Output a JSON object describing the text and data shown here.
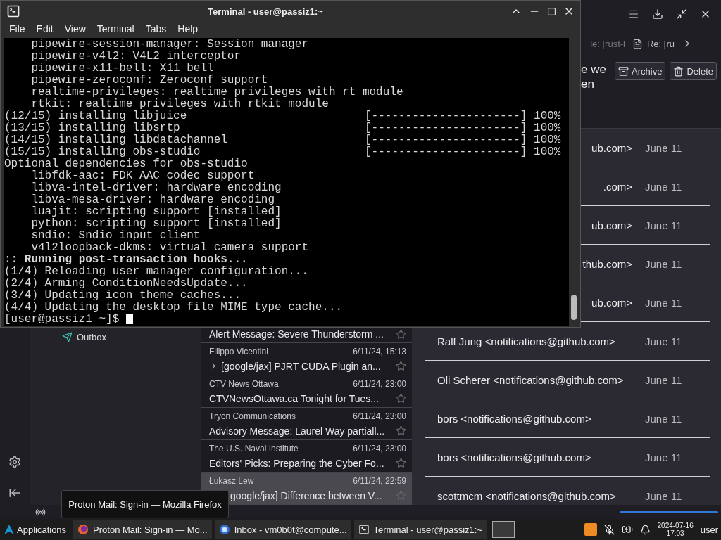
{
  "terminal": {
    "title": "Terminal - user@passiz1:~",
    "menu": [
      "File",
      "Edit",
      "View",
      "Terminal",
      "Tabs",
      "Help"
    ],
    "lines": [
      {
        "text": "    pipewire-session-manager: Session manager"
      },
      {
        "text": "    pipewire-v4l2: V4L2 interceptor"
      },
      {
        "text": "    pipewire-x11-bell: X11 bell"
      },
      {
        "text": "    pipewire-zeroconf: Zeroconf support"
      },
      {
        "text": "    realtime-privileges: realtime privileges with rt module"
      },
      {
        "text": "    rtkit: realtime privileges with rtkit module"
      },
      {
        "text": "(12/15) installing libjuice",
        "progress": "[----------------------] 100%"
      },
      {
        "text": "(13/15) installing libsrtp",
        "progress": "[----------------------] 100%"
      },
      {
        "text": "(14/15) installing libdatachannel",
        "progress": "[----------------------] 100%"
      },
      {
        "text": "(15/15) installing obs-studio",
        "progress": "[----------------------] 100%"
      },
      {
        "text": "Optional dependencies for obs-studio"
      },
      {
        "text": "    libfdk-aac: FDK AAC codec support"
      },
      {
        "text": "    libva-intel-driver: hardware encoding"
      },
      {
        "text": "    libva-mesa-driver: hardware encoding"
      },
      {
        "text": "    luajit: scripting support [installed]"
      },
      {
        "text": "    python: scripting support [installed]"
      },
      {
        "text": "    sndio: Sndio input client"
      },
      {
        "text": "    v4l2loopback-dkms: virtual camera support"
      },
      {
        "text": ":: **Running post-transaction hooks...**"
      },
      {
        "text": "(1/4) Reloading user manager configuration..."
      },
      {
        "text": "(2/4) Arming ConditionNeedsUpdate..."
      },
      {
        "text": "(3/4) Updating icon theme caches..."
      },
      {
        "text": "(4/4) Updating the desktop file MIME type cache..."
      }
    ],
    "prompt": "[user@passiz1 ~]$ "
  },
  "mail": {
    "tabs": [
      {
        "label": "le: [rust-l",
        "cut": true
      },
      {
        "label": "Re: [ru",
        "cut": false
      }
    ],
    "subject_lines": [
      "e we",
      "en"
    ],
    "actions": [
      {
        "label": "Archive",
        "kind": "archive"
      },
      {
        "label": "Delete",
        "kind": "delete"
      }
    ],
    "folders": [
      {
        "name": "Outbox"
      }
    ],
    "threads": [
      {
        "subject": "Alert Message: Severe Thunderstorm ...",
        "kind": "partial",
        "selected": false
      },
      {
        "sender": "Filippo Vicentini",
        "date": "6/11/24, 15:13",
        "subject": "[google/jax] PJRT CUDA Plugin an...",
        "kind": "full",
        "thread": true,
        "selected": false
      },
      {
        "sender": "CTV News Ottawa",
        "date": "6/11/24, 23:00",
        "subject": "CTVNewsOttawa.ca Tonight for Tues...",
        "kind": "full",
        "thread": false,
        "selected": false
      },
      {
        "sender": "Tryon Communications",
        "date": "6/11/24, 23:00",
        "subject": "Advisory Message: Laurel Way partiall...",
        "kind": "full",
        "thread": false,
        "selected": false
      },
      {
        "sender": "The U.S. Naval Institute",
        "date": "6/11/24, 23:00",
        "subject": "Editors' Picks: Preparing the Cyber Fo...",
        "kind": "full",
        "thread": false,
        "selected": false
      },
      {
        "sender": "Łukasz Lew",
        "date": "6/11/24, 22:59",
        "subject": "google/jax] Difference between V...",
        "kind": "covered",
        "thread": false,
        "selected": true
      }
    ],
    "results": [
      {
        "sender": "ub.com>",
        "date": "June 11",
        "cut": true
      },
      {
        "sender": ".com>",
        "date": "June 11",
        "cut": true
      },
      {
        "sender": "ub.com>",
        "date": "June 11",
        "cut": true
      },
      {
        "sender": "thub.com>",
        "date": "June 11",
        "cut": true
      },
      {
        "sender": "ub.com>",
        "date": "June 11",
        "cut": true
      },
      {
        "sender": "Ralf Jung <notifications@github.com>",
        "date": "June 11",
        "cut": false
      },
      {
        "sender": "Oli Scherer <notifications@github.com>",
        "date": "June 11",
        "cut": false
      },
      {
        "sender": "bors <notifications@github.com>",
        "date": "June 11",
        "cut": false
      },
      {
        "sender": "bors <notifications@github.com>",
        "date": "June 11",
        "cut": false
      },
      {
        "sender": "scottmcm <notifications@github.com>",
        "date": "June 11",
        "cut": false
      }
    ]
  },
  "tooltip": "Proton Mail: Sign-in — Mozilla Firefox",
  "taskbar": {
    "menu": "Applications",
    "windows": [
      {
        "label": "Proton Mail: Sign-in — Mo...",
        "kind": "browser"
      },
      {
        "label": "Inbox - vm0b0t@compute...",
        "kind": "mail"
      },
      {
        "label": "Terminal - user@passiz1:~",
        "kind": "terminal"
      }
    ],
    "date": "2024-07-16",
    "time": "17:03",
    "user": "user"
  }
}
